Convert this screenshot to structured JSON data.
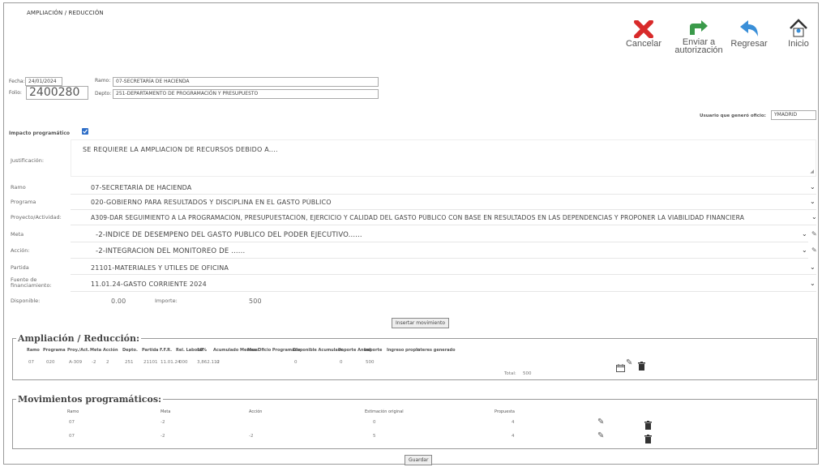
{
  "page_title": "AMPLIACIÓN / REDUCCIÓN",
  "toolbar": {
    "cancel": "Cancelar",
    "send_line1": "Enviar a",
    "send_line2": "autorización",
    "back": "Regresar",
    "home": "Inicio"
  },
  "header": {
    "fecha_label": "Fecha:",
    "fecha_value": "24/01/2024",
    "folio_label": "Folio:",
    "folio_value": "2400280",
    "ramo_label": "Ramo:",
    "ramo_value": "07-SECRETARÍA DE HACIENDA",
    "depto_label": "Depto:",
    "depto_value": "251-DEPARTAMENTO DE PROGRAMACIÓN Y PRESUPUESTO",
    "usuario_label": "Usuario que generó oficio:",
    "usuario_value": "YMADRID"
  },
  "impacto_label": "Impacto programático",
  "justificacion_label": "Justificación:",
  "justificacion_value": "SE REQUIERE LA AMPLIACION DE RECURSOS DEBIDO A....",
  "form": {
    "ramo_label": "Ramo",
    "ramo_value": "07-SECRETARÍA DE HACIENDA",
    "programa_label": "Programa",
    "programa_value": "020-GOBIERNO PARA RESULTADOS Y DISCIPLINA EN EL GASTO PÚBLICO",
    "proyecto_label": "Proyecto/Actividad:",
    "proyecto_value": "A309-DAR SEGUIMIENTO A LA PROGRAMACIÓN, PRESUPUESTACIÓN, EJERCICIO Y CALIDAD DEL GASTO PÚBLICO CON BASE EN RESULTADOS EN LAS DEPENDENCIAS Y PROPONER LA VIABILIDAD FINANCIERA",
    "meta_label": "Meta",
    "meta_value": "-2-ÍNDICE DE DESEMPEÑO DEL GASTO PÚBLICO DEL PODER EJECUTIVO......",
    "accion_label": "Acción:",
    "accion_value": "-2-INTEGRACIÓN DEL MONITOREO DE ......",
    "partida_label": "Partida",
    "partida_value": "21101-MATERIALES Y UTILES DE OFICINA",
    "fuente_label_1": "Fuente de",
    "fuente_label_2": "financiamiento:",
    "fuente_value": "11.01.24-GASTO CORRIENTE 2024",
    "disponible_label": "Disponible:",
    "disponible_value": "0.00",
    "importe_label": "Importe:",
    "importe_value": "500"
  },
  "insert_button": "Insertar movimiento",
  "ampliacion": {
    "legend": "Ampliación / Reducción:",
    "headers": [
      "Ramo",
      "Programa",
      "Proy./Act.",
      "Meta",
      "Acción",
      "Depto.",
      "Partida",
      "F.F.R.",
      "Rel. Laboral",
      "10%",
      "Acumulado Mensual",
      "Mes Oficio Programado",
      "Disponible Acumulado",
      "Importe Anual",
      "Importe",
      "Ingreso propio",
      "Interes generado"
    ],
    "row": [
      "07",
      "020",
      "A-309",
      "-2",
      "2",
      "251",
      "21101",
      "11.01.24",
      "000",
      "3,862.112",
      "0",
      "",
      "0",
      "0",
      "500",
      "",
      ""
    ],
    "total_label": "Total:",
    "total_value": "500"
  },
  "movimientos": {
    "legend": "Movimientos programáticos:",
    "headers": [
      "Ramo",
      "Meta",
      "Acción",
      "Estimación original",
      "Propuesta"
    ],
    "rows": [
      [
        "07",
        "-2",
        "",
        "0",
        "4"
      ],
      [
        "07",
        "-2",
        "-2",
        "5",
        "4"
      ]
    ]
  },
  "guardar_button": "Guardar",
  "colors": {
    "cancel": "#d82a2a",
    "send": "#3a9a4a",
    "back": "#3a8fd8",
    "home": "#333333",
    "checkbox": "#2f6fc8"
  }
}
